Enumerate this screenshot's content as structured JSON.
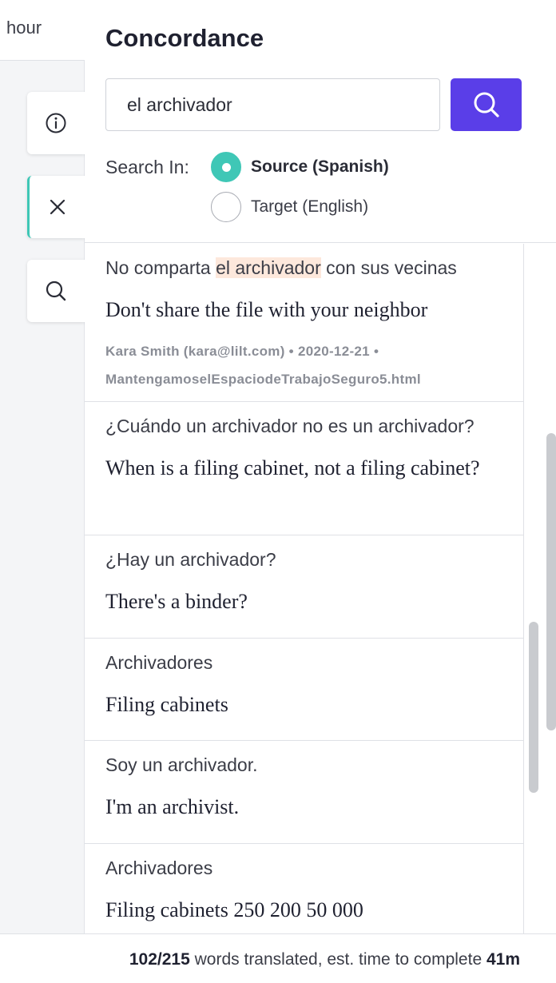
{
  "left": {
    "partial_text": "hour"
  },
  "panel": {
    "title": "Concordance",
    "search": {
      "value": "el archivador",
      "button_icon": "search-icon"
    },
    "search_in": {
      "label": "Search In:",
      "options": [
        {
          "label": "Source (Spanish)",
          "checked": true
        },
        {
          "label": "Target (English)",
          "checked": false
        }
      ]
    },
    "results": [
      {
        "source_before": "No comparta ",
        "source_highlight": "el archivador",
        "source_after": " con sus vecinas",
        "target": "Don't share the file with your neighbor",
        "meta_line1": "Kara Smith (kara@lilt.com) • 2020-12-21 •",
        "meta_line2": "MantengamoselEspaciodeTrabajoSeguro5.html"
      },
      {
        "source": "¿Cuándo un archivador no es un archivador?",
        "target": "When is a filing cabinet, not a filing cabinet?"
      },
      {
        "source": "¿Hay un archivador?",
        "target": "There's a binder?"
      },
      {
        "source": "Archivadores",
        "target": "Filing cabinets"
      },
      {
        "source": "Soy un archivador.",
        "target": "I'm an archivist."
      },
      {
        "source": "Archivadores",
        "target": "Filing cabinets 250 200 50 000"
      }
    ]
  },
  "footer": {
    "count": "102/215",
    "middle": " words translated, est. time to complete ",
    "time": "41m"
  },
  "colors": {
    "accent_purple": "#5a3ee8",
    "accent_teal": "#3fc7b6",
    "highlight": "#fde8dc"
  }
}
